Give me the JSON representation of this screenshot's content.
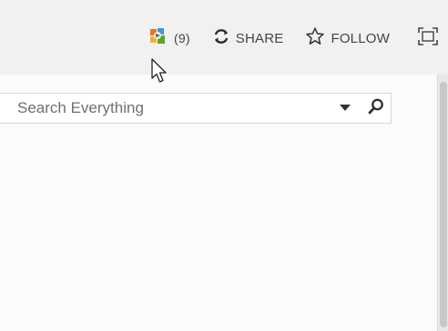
{
  "header": {
    "newsfeed": {
      "count": "(9)",
      "icon": "colorful-app-icon"
    },
    "share": {
      "label": "SHARE",
      "icon": "sync-icon"
    },
    "follow": {
      "label": "FOLLOW",
      "icon": "star-outline-icon"
    },
    "focus": {
      "icon": "focus-frame-icon"
    }
  },
  "search": {
    "placeholder": "Search Everything",
    "scope_icon": "caret-down-icon",
    "go_icon": "search-magnifier-icon"
  },
  "colors": {
    "topbar_bg": "#f1f1f1",
    "content_bg": "#fbfbfb",
    "text": "#444444"
  }
}
